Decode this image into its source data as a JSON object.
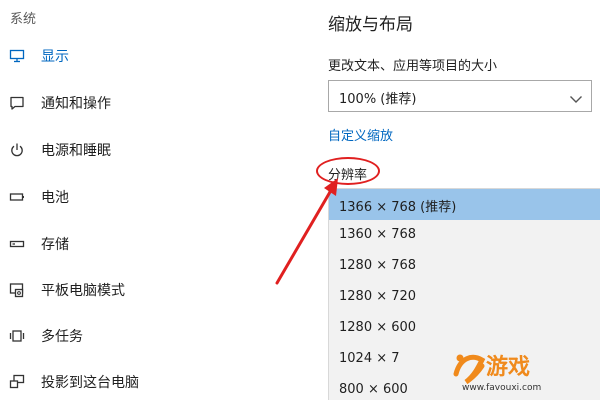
{
  "sidebar": {
    "header": "系统",
    "items": [
      {
        "label": "显示",
        "icon": "monitor-icon",
        "active": true
      },
      {
        "label": "通知和操作",
        "icon": "notification-icon",
        "active": false
      },
      {
        "label": "电源和睡眠",
        "icon": "power-icon",
        "active": false
      },
      {
        "label": "电池",
        "icon": "battery-icon",
        "active": false
      },
      {
        "label": "存储",
        "icon": "storage-icon",
        "active": false
      },
      {
        "label": "平板电脑模式",
        "icon": "tablet-mode-icon",
        "active": false
      },
      {
        "label": "多任务",
        "icon": "multitasking-icon",
        "active": false
      },
      {
        "label": "投影到这台电脑",
        "icon": "project-icon",
        "active": false
      }
    ]
  },
  "main": {
    "section_title": "缩放与布局",
    "scale_label": "更改文本、应用等项目的大小",
    "scale_value": "100% (推荐)",
    "custom_scale_link": "自定义缩放",
    "resolution_label": "分辨率",
    "resolution_options": [
      {
        "label": "1366 × 768 (推荐)",
        "selected": true
      },
      {
        "label": "1360 × 768",
        "selected": false
      },
      {
        "label": "1280 × 768",
        "selected": false
      },
      {
        "label": "1280 × 720",
        "selected": false
      },
      {
        "label": "1280 × 600",
        "selected": false
      },
      {
        "label": "1024 × 7",
        "selected": false
      },
      {
        "label": "800 × 600",
        "selected": false
      }
    ]
  },
  "annotation": {
    "color": "#e02020"
  },
  "watermark": {
    "logo_text": "游戏",
    "url": "www.favouxi.com"
  },
  "colors": {
    "accent": "#0067c0",
    "selected_bg": "#99c4ea",
    "list_bg": "#f2f2f2"
  }
}
